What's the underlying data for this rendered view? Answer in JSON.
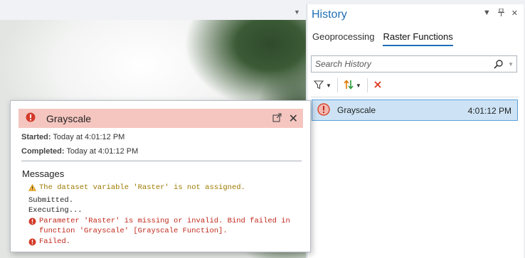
{
  "history_panel": {
    "title": "History",
    "tabs": [
      {
        "label": "Geoprocessing",
        "active": false
      },
      {
        "label": "Raster Functions",
        "active": true
      }
    ],
    "search_placeholder": "Search History",
    "entries": [
      {
        "status": "error",
        "name": "Grayscale",
        "time": "4:01:12 PM",
        "selected": true
      }
    ]
  },
  "popup": {
    "title": "Grayscale",
    "status": "error",
    "started_label": "Started:",
    "started_value": "Today at 4:01:12 PM",
    "completed_label": "Completed:",
    "completed_value": "Today at 4:01:12 PM",
    "messages_heading": "Messages",
    "messages": [
      {
        "type": "warning",
        "text": "The dataset variable 'Raster' is not assigned."
      },
      {
        "type": "info",
        "text": "Submitted."
      },
      {
        "type": "info",
        "text": "Executing..."
      },
      {
        "type": "error",
        "text": "Parameter 'Raster' is missing or invalid. Bind failed in function 'Grayscale' [Grayscale Function]."
      },
      {
        "type": "error",
        "text": "Failed."
      }
    ]
  },
  "colors": {
    "accent": "#1f6fb5",
    "error": "#c0281c",
    "warning": "#e0a100",
    "popup_header_bg": "#f5c6c0",
    "selected_row_bg": "#cde3f5"
  }
}
